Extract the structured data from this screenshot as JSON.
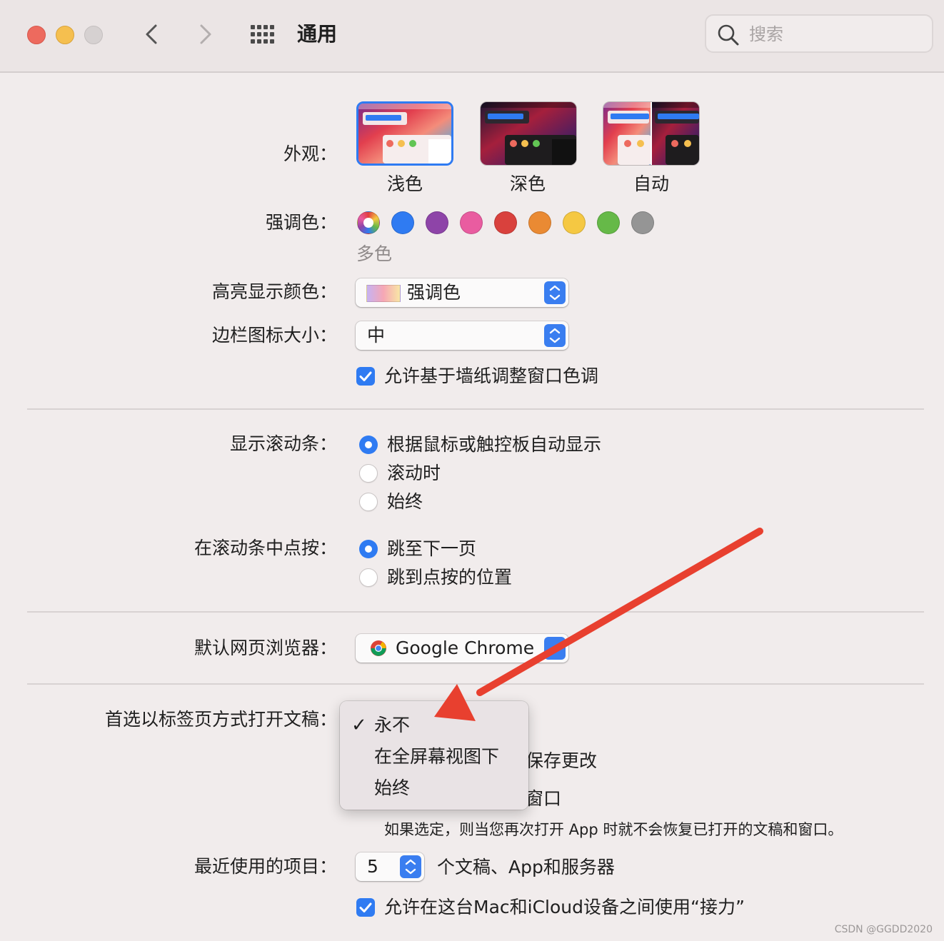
{
  "window": {
    "title": "通用",
    "search_placeholder": "搜索"
  },
  "colors": {
    "accent": "#2f7bf2",
    "traffic_close": "#ed6a5e",
    "traffic_minimize": "#f5bf4f",
    "traffic_zoom": "#d6d1d1",
    "annotation_arrow": "#e8402f"
  },
  "appearance": {
    "label": "外观：",
    "options": [
      {
        "name": "浅色",
        "selected": true
      },
      {
        "name": "深色",
        "selected": false
      },
      {
        "name": "自动",
        "selected": false
      }
    ]
  },
  "accent_color": {
    "label": "强调色：",
    "selected_caption": "多色",
    "swatches": [
      "multicolor",
      "#2f7bf2",
      "#8e44a8",
      "#e95ca0",
      "#d9413d",
      "#ea8a33",
      "#f5c842",
      "#66b948",
      "#959595"
    ]
  },
  "highlight_color": {
    "label": "高亮显示颜色：",
    "value": "强调色"
  },
  "sidebar_icon_size": {
    "label": "边栏图标大小：",
    "value": "中"
  },
  "wallpaper_tinting": {
    "label": "允许基于墙纸调整窗口色调",
    "checked": true
  },
  "show_scroll_bars": {
    "label": "显示滚动条：",
    "options": [
      {
        "label": "根据鼠标或触控板自动显示",
        "selected": true
      },
      {
        "label": "滚动时",
        "selected": false
      },
      {
        "label": "始终",
        "selected": false
      }
    ]
  },
  "click_scroll_bar": {
    "label": "在滚动条中点按：",
    "options": [
      {
        "label": "跳至下一页",
        "selected": true
      },
      {
        "label": "跳到点按的位置",
        "selected": false
      }
    ]
  },
  "default_browser": {
    "label": "默认网页浏览器：",
    "value": "Google Chrome"
  },
  "prefer_tabs": {
    "label": "首选以标签页方式打开文稿：",
    "menu_items": [
      {
        "label": "永不",
        "checked": true
      },
      {
        "label": "在全屏幕视图下",
        "checked": false
      },
      {
        "label": "始终",
        "checked": false
      }
    ],
    "checkmark": "✓"
  },
  "partially_hidden": {
    "ask_keep_changes_fragment": "保存更改",
    "close_windows_fragment": "窗口"
  },
  "close_windows_note": "如果选定，则当您再次打开 App 时就不会恢复已打开的文稿和窗口。",
  "recent_items": {
    "label": "最近使用的项目：",
    "value": "5",
    "suffix": "个文稿、App和服务器"
  },
  "handoff": {
    "label": "允许在这台Mac和iCloud设备之间使用“接力”",
    "checked": true
  },
  "watermark": "CSDN @GGDD2020"
}
